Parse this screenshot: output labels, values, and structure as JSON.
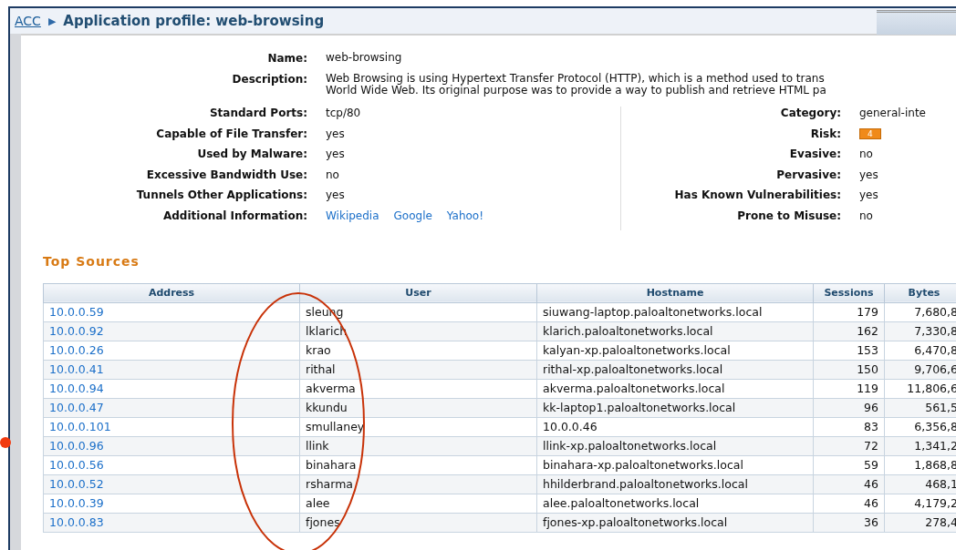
{
  "breadcrumb": {
    "root": "ACC",
    "separator": "▶",
    "title": "Application profile: web-browsing"
  },
  "details_left": [
    {
      "label": "Name:",
      "value": "web-browsing"
    },
    {
      "label": "Description:",
      "lines": [
        "Web Browsing is using Hypertext Transfer Protocol (HTTP), which is a method used to trans",
        "World Wide Web. Its original purpose was to provide a way to publish and retrieve HTML pa"
      ]
    }
  ],
  "details_split": {
    "left": [
      {
        "label": "Standard Ports:",
        "value": "tcp/80"
      },
      {
        "label": "Capable of File Transfer:",
        "value": "yes"
      },
      {
        "label": "Used by Malware:",
        "value": "yes"
      },
      {
        "label": "Excessive Bandwidth Use:",
        "value": "no"
      },
      {
        "label": "Tunnels Other Applications:",
        "value": "yes"
      },
      {
        "label": "Additional Information:",
        "links": [
          "Wikipedia",
          "Google",
          "Yahoo!"
        ]
      }
    ],
    "right": [
      {
        "label": "Category:",
        "value": "general-inte"
      },
      {
        "label": "Risk:",
        "badge": "4"
      },
      {
        "label": "Evasive:",
        "value": "no"
      },
      {
        "label": "Pervasive:",
        "value": "yes"
      },
      {
        "label": "Has Known Vulnerabilities:",
        "value": "yes"
      },
      {
        "label": "Prone to Misuse:",
        "value": "no"
      }
    ]
  },
  "top_sources": {
    "title": "Top Sources",
    "columns": [
      "Address",
      "User",
      "Hostname",
      "Sessions",
      "Bytes"
    ],
    "rows": [
      [
        "10.0.0.59",
        "sleung",
        "siuwang-laptop.paloaltonetworks.local",
        "179",
        "7,680,8"
      ],
      [
        "10.0.0.92",
        "lklarich",
        "klarich.paloaltonetworks.local",
        "162",
        "7,330,8"
      ],
      [
        "10.0.0.26",
        "krao",
        "kalyan-xp.paloaltonetworks.local",
        "153",
        "6,470,8"
      ],
      [
        "10.0.0.41",
        "rithal",
        "rithal-xp.paloaltonetworks.local",
        "150",
        "9,706,6"
      ],
      [
        "10.0.0.94",
        "akverma",
        "akverma.paloaltonetworks.local",
        "119",
        "11,806,6"
      ],
      [
        "10.0.0.47",
        "kkundu",
        "kk-laptop1.paloaltonetworks.local",
        "96",
        "561,5"
      ],
      [
        "10.0.0.101",
        "smullaney",
        "10.0.0.46",
        "83",
        "6,356,8"
      ],
      [
        "10.0.0.96",
        "llink",
        "llink-xp.paloaltonetworks.local",
        "72",
        "1,341,2"
      ],
      [
        "10.0.0.56",
        "binahara",
        "binahara-xp.paloaltonetworks.local",
        "59",
        "1,868,8"
      ],
      [
        "10.0.0.52",
        "rsharma",
        "hhilderbrand.paloaltonetworks.local",
        "46",
        "468,1"
      ],
      [
        "10.0.0.39",
        "alee",
        "alee.paloaltonetworks.local",
        "46",
        "4,179,2"
      ],
      [
        "10.0.0.83",
        "fjones",
        "fjones-xp.paloaltonetworks.local",
        "36",
        "278,4"
      ]
    ]
  }
}
